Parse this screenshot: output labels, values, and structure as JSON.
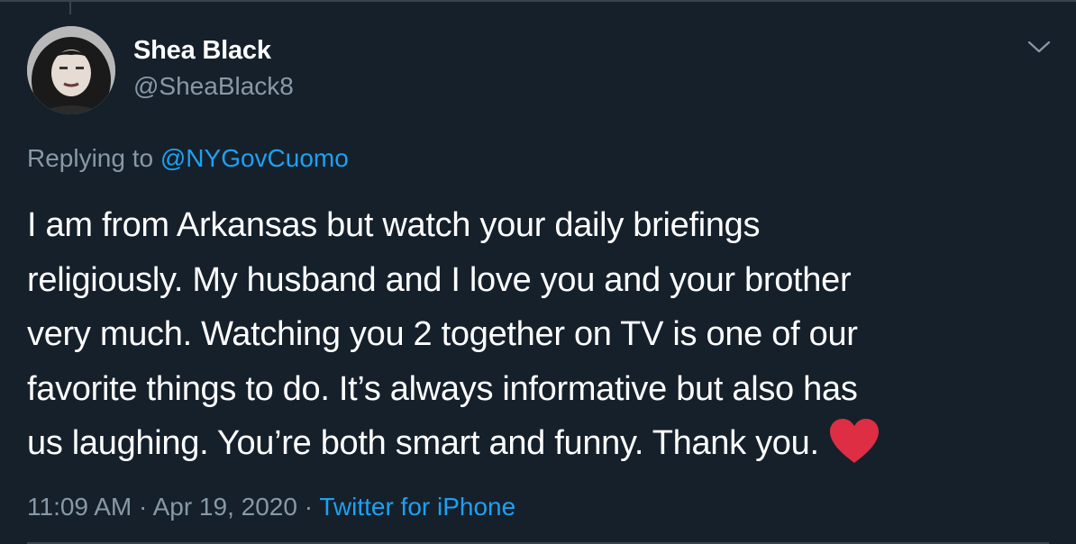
{
  "tweet": {
    "author_name": "Shea Black",
    "author_handle": "@SheaBlack8",
    "replying_prefix": "Replying to",
    "replying_to": "@NYGovCuomo",
    "body_lines": [
      "I am from Arkansas but watch your daily briefings",
      "religiously. My husband and I love you and your brother",
      "very much. Watching you 2 together on TV is one of our",
      "favorite things to do. It’s always informative but also has",
      "us laughing. You’re both smart and funny. Thank you."
    ],
    "time": "11:09 AM",
    "separator": "·",
    "date": "Apr 19, 2020",
    "source": "Twitter for iPhone"
  },
  "icons": {
    "menu": "chevron-down-icon",
    "emoji": "red-heart-icon"
  },
  "colors": {
    "background": "#15202b",
    "primary_text": "#ffffff",
    "secondary_text": "#8899a6",
    "link": "#1da1f2",
    "heart": "#e0245e",
    "divider": "#38444d"
  }
}
